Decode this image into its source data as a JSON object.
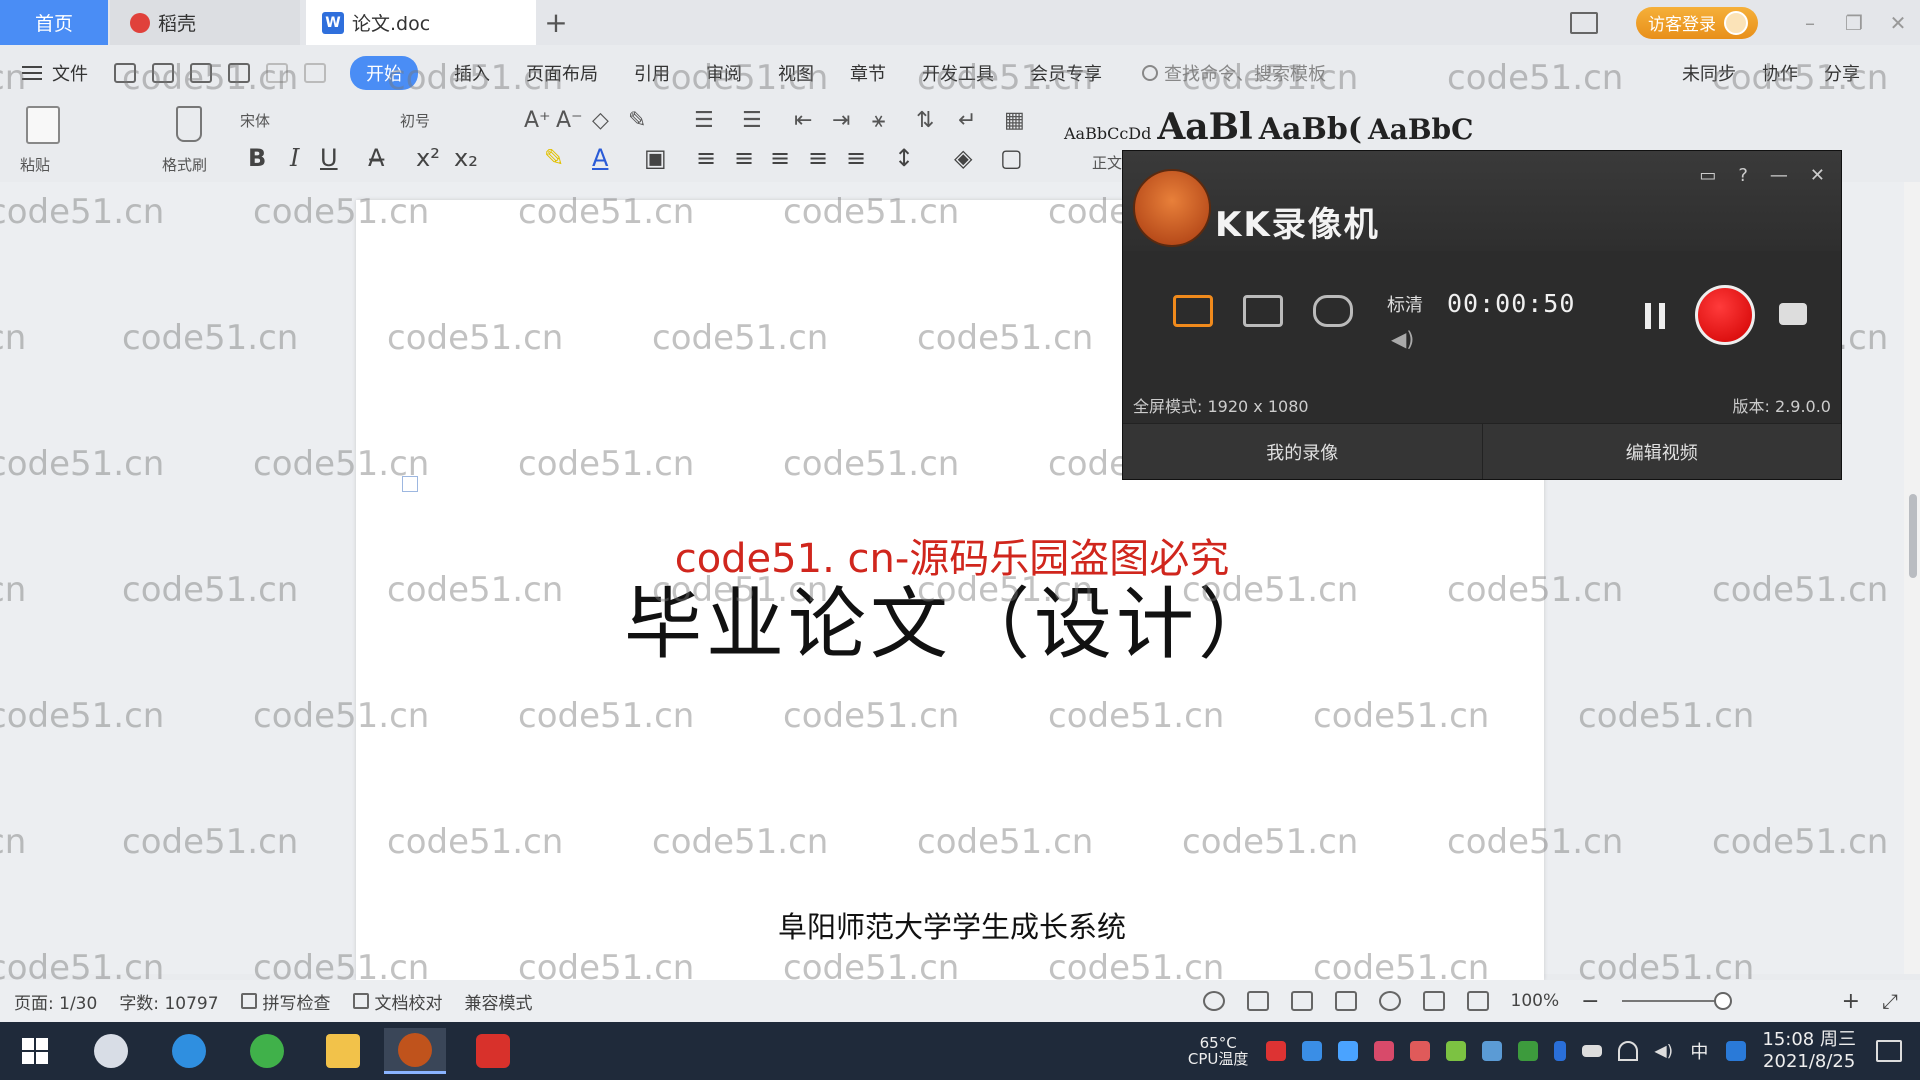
{
  "tabs": {
    "home": "首页",
    "daoke": "稻壳",
    "doc": "论文.doc",
    "add": "+"
  },
  "titlebar": {
    "login": "访客登录"
  },
  "menu": {
    "file": "文件",
    "items": [
      "开始",
      "插入",
      "页面布局",
      "引用",
      "审阅",
      "视图",
      "章节",
      "开发工具",
      "会员专享"
    ],
    "search_cmd": "查找命令、搜索模板",
    "sync": "未同步",
    "collab": "协作",
    "share": "分享"
  },
  "ribbon": {
    "paste": "粘贴",
    "format_painter": "格式刷",
    "font_name": "宋体",
    "font_size": "初号",
    "bold": "B",
    "italic": "I",
    "underline": "U",
    "styles": [
      "AaBbCcDd",
      "AaBl",
      "AaBb(",
      "AaBbC"
    ],
    "style_normal": "正文"
  },
  "document": {
    "watermark_red": "code51. cn-源码乐园盗图必究",
    "title": "毕业论文（设计）",
    "subtitle": "阜阳师范大学学生成长系统"
  },
  "watermark": "code51.cn",
  "recorder": {
    "title": "KK录像机",
    "quality": "标清",
    "timer": "00:00:50",
    "mode_info": "全屏模式: 1920 x 1080",
    "version": "版本: 2.9.0.0",
    "my_recordings": "我的录像",
    "edit_video": "编辑视频"
  },
  "status": {
    "page": "页面: 1/30",
    "words": "字数: 10797",
    "spellcheck": "拼写检查",
    "doc_check": "文档校对",
    "compat": "兼容模式",
    "zoom": "100%",
    "zoom_minus": "−",
    "zoom_plus": "+"
  },
  "taskbar": {
    "cpu_temp": "65°C",
    "cpu_label": "CPU温度",
    "ime": "中",
    "time": "15:08 周三",
    "date": "2021/8/25"
  },
  "colors": {
    "accent": "#4a8df5",
    "watermark_red": "#d0261d",
    "record": "#e00000"
  }
}
